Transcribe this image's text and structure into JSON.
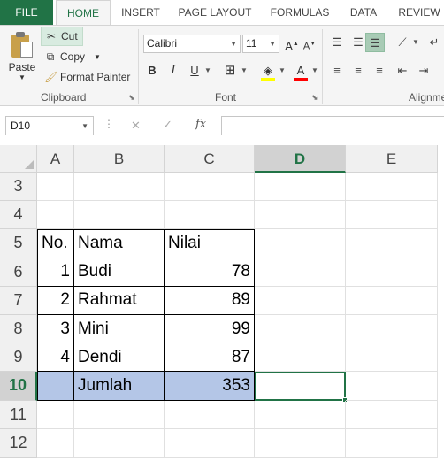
{
  "ribbon_tabs": [
    "FILE",
    "HOME",
    "INSERT",
    "PAGE LAYOUT",
    "FORMULAS",
    "DATA",
    "REVIEW"
  ],
  "clipboard": {
    "paste_label": "Paste",
    "cut_label": "Cut",
    "copy_label": "Copy",
    "format_painter_label": "Format Painter",
    "group_label": "Clipboard"
  },
  "font": {
    "font_name": "Calibri",
    "font_size": "11",
    "group_label": "Font",
    "bold": "B",
    "italic": "I",
    "underline": "U",
    "font_color_letter": "A",
    "font_color": "#ff0000",
    "fill_color": "#ffff00",
    "grow": "A",
    "shrink": "A"
  },
  "alignment": {
    "group_label": "Alignme"
  },
  "formula_bar": {
    "name_box": "D10",
    "fx": "fx",
    "formula": ""
  },
  "grid": {
    "columns": [
      "A",
      "B",
      "C",
      "D",
      "E"
    ],
    "active_column": "D",
    "active_row": "10",
    "rows": [
      {
        "row": "3",
        "cells": [
          "",
          "",
          "",
          "",
          ""
        ]
      },
      {
        "row": "4",
        "cells": [
          "",
          "",
          "",
          "",
          ""
        ]
      },
      {
        "row": "5",
        "cells": [
          "No.",
          "Nama",
          "Nilai",
          "",
          ""
        ]
      },
      {
        "row": "6",
        "cells": [
          "1",
          "Budi",
          "78",
          "",
          ""
        ]
      },
      {
        "row": "7",
        "cells": [
          "2",
          "Rahmat",
          "89",
          "",
          ""
        ]
      },
      {
        "row": "8",
        "cells": [
          "3",
          "Mini",
          "99",
          "",
          ""
        ]
      },
      {
        "row": "9",
        "cells": [
          "4",
          "Dendi",
          "87",
          "",
          ""
        ]
      },
      {
        "row": "10",
        "cells": [
          "",
          "Jumlah",
          "353",
          "",
          ""
        ]
      },
      {
        "row": "11",
        "cells": [
          "",
          "",
          "",
          "",
          ""
        ]
      },
      {
        "row": "12",
        "cells": [
          "",
          "",
          "",
          "",
          ""
        ]
      }
    ],
    "highlight_color": "#b4c6e7",
    "selection_color": "#217346"
  }
}
